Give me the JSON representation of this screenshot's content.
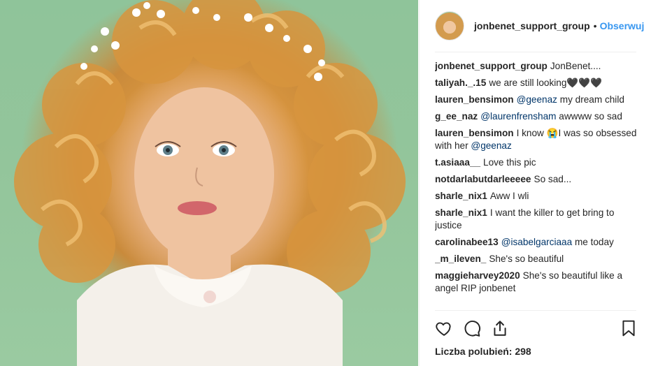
{
  "post": {
    "username": "jonbenet_support_group",
    "dot": "•",
    "follow_label": "Obserwuj",
    "comments": [
      {
        "user": "jonbenet_support_group",
        "text": "JonBenet...."
      },
      {
        "user": "taliyah._.15",
        "text": "we are still looking🖤🖤🖤"
      },
      {
        "user": "lauren_bensimon",
        "mention": "@geenaz",
        "text": "my dream child"
      },
      {
        "user": "g_ee_naz",
        "mention": "@laurenfrensham",
        "text": "awwww so sad"
      },
      {
        "user": "lauren_bensimon",
        "text": "I know 😭I was so obsessed with her",
        "mention": "@geenaz"
      },
      {
        "user": "t.asiaaa__",
        "text": "Love this pic"
      },
      {
        "user": "notdarlabutdarleeeee",
        "text": "So sad..."
      },
      {
        "user": "sharle_nix1",
        "text": "Aww I wli"
      },
      {
        "user": "sharle_nix1",
        "text": "I want the killer to get bring to justice"
      },
      {
        "user": "carolinabee13",
        "mention": "@isabelgarciaaa",
        "text": "me today"
      },
      {
        "user": "_m_ileven_",
        "text": "She's so beautiful"
      },
      {
        "user": "maggieharvey2020",
        "text": "She's so beautiful like a angel RIP jonbenet"
      }
    ],
    "likes_label": "Liczba polubień: 298"
  },
  "icons": {
    "like": "heart-icon",
    "comment": "comment-icon",
    "share": "share-icon",
    "save": "bookmark-icon"
  },
  "colors": {
    "accent": "#3897f0",
    "text": "#262626",
    "mention": "#003569",
    "photo_background": "#93c59b"
  }
}
